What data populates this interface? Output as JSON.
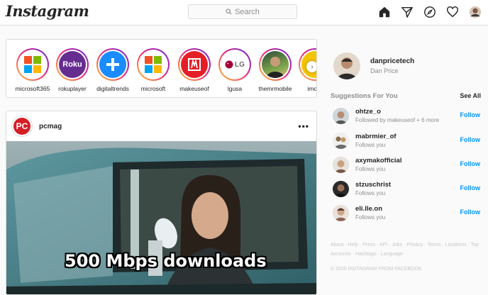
{
  "header": {
    "logo": "Instagram",
    "search_placeholder": "Search"
  },
  "stories": [
    {
      "name": "microsoft365"
    },
    {
      "name": "rokuplayer"
    },
    {
      "name": "digitaltrends"
    },
    {
      "name": "microsoft"
    },
    {
      "name": "makeuseof"
    },
    {
      "name": "lgusa"
    },
    {
      "name": "themrmobile"
    },
    {
      "name": "imore"
    }
  ],
  "story_logos": {
    "roku": "Roku",
    "lg": "LG"
  },
  "post": {
    "username": "pcmag",
    "avatar_text": "PC",
    "caption": "500 Mbps downloads"
  },
  "profile": {
    "username": "danpricetech",
    "fullname": "Dan Price"
  },
  "suggestions": {
    "title": "Suggestions For You",
    "see_all": "See All",
    "follow_label": "Follow",
    "items": [
      {
        "username": "ohtze_o",
        "sub": "Followed by makeuseof + 6 more"
      },
      {
        "username": "mabrmier_of",
        "sub": "Follows you"
      },
      {
        "username": "axymakofficial",
        "sub": "Follows you"
      },
      {
        "username": "stzuschrist",
        "sub": "Follows you"
      },
      {
        "username": "eli.lle.on",
        "sub": "Follows you"
      }
    ]
  },
  "footer": {
    "links": "About · Help · Press · API · Jobs · Privacy · Terms · Locations · Top Accounts · Hashtags · Language",
    "copyright": "© 2020 INSTAGRAM FROM FACEBOOK"
  },
  "colors": {
    "link_blue": "#0095f6",
    "border": "#dbdbdb",
    "muted": "#8e8e8e"
  }
}
